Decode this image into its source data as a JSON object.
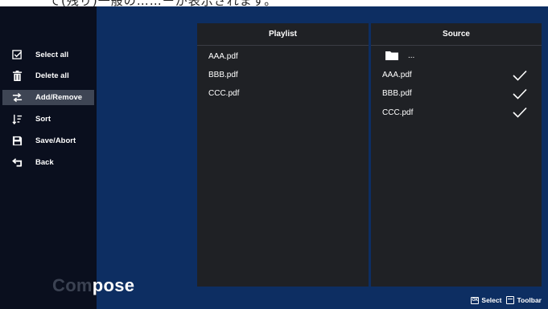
{
  "caption": "て(残り)一般の……ーが表示されます。",
  "toolbar": {
    "items": [
      {
        "label": "Select all",
        "icon": "select-all-icon"
      },
      {
        "label": "Delete all",
        "icon": "trash-icon"
      },
      {
        "label": "Add/Remove",
        "icon": "swap-arrows-icon",
        "selected": true
      },
      {
        "label": "Sort",
        "icon": "sort-icon"
      },
      {
        "label": "Save/Abort",
        "icon": "save-icon"
      },
      {
        "label": "Back",
        "icon": "back-arrow-icon"
      }
    ]
  },
  "screen_title": {
    "dim": "Com",
    "bright": "pose"
  },
  "playlist": {
    "header": "Playlist",
    "items": [
      "AAA.pdf",
      "BBB.pdf",
      "CCC.pdf"
    ]
  },
  "source": {
    "header": "Source",
    "folder_label": "...",
    "items": [
      {
        "name": "AAA.pdf",
        "checked": true
      },
      {
        "name": "BBB.pdf",
        "checked": true
      },
      {
        "name": "CCC.pdf",
        "checked": true
      }
    ]
  },
  "hint": {
    "ok_icon_text": "OK",
    "select_label": "Select",
    "toolbar_label": "Toolbar"
  },
  "colors": {
    "screen_bg": "#0d2e62",
    "toolbar_bg": "#0a0f1e",
    "panel_bg": "#1f2125",
    "selected_bg": "#3e4554"
  }
}
